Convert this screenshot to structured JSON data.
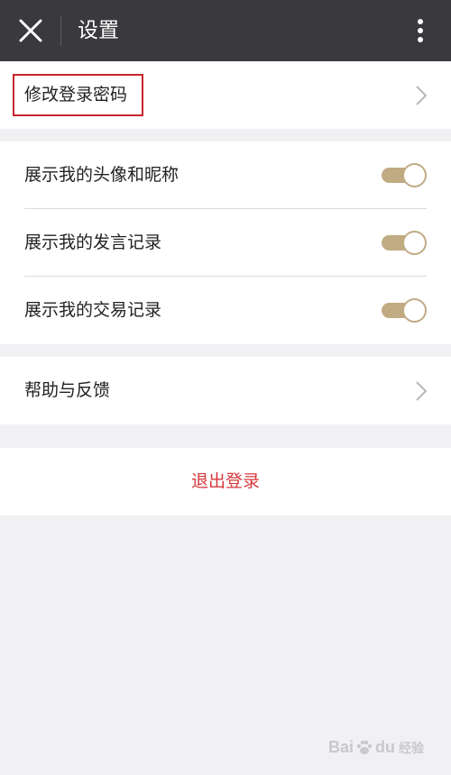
{
  "header": {
    "title": "设置",
    "close_icon": "close-icon",
    "more_icon": "more-vertical-icon"
  },
  "account": {
    "change_password_label": "修改登录密码",
    "chevron_icon": "chevron-right-icon"
  },
  "privacy": {
    "items": [
      {
        "label": "展示我的头像和昵称",
        "enabled": true
      },
      {
        "label": "展示我的发言记录",
        "enabled": true
      },
      {
        "label": "展示我的交易记录",
        "enabled": true
      }
    ]
  },
  "support": {
    "help_feedback_label": "帮助与反馈",
    "chevron_icon": "chevron-right-icon"
  },
  "logout": {
    "label": "退出登录"
  },
  "watermark": {
    "text_left": "Bai",
    "text_right": "du",
    "text_suffix": "经验"
  },
  "colors": {
    "header_bg": "#3a393e",
    "toggle_on": "#c0ab83",
    "logout_text": "#d6383c",
    "highlight_border": "#c8252c",
    "page_bg": "#f1f0f3"
  }
}
